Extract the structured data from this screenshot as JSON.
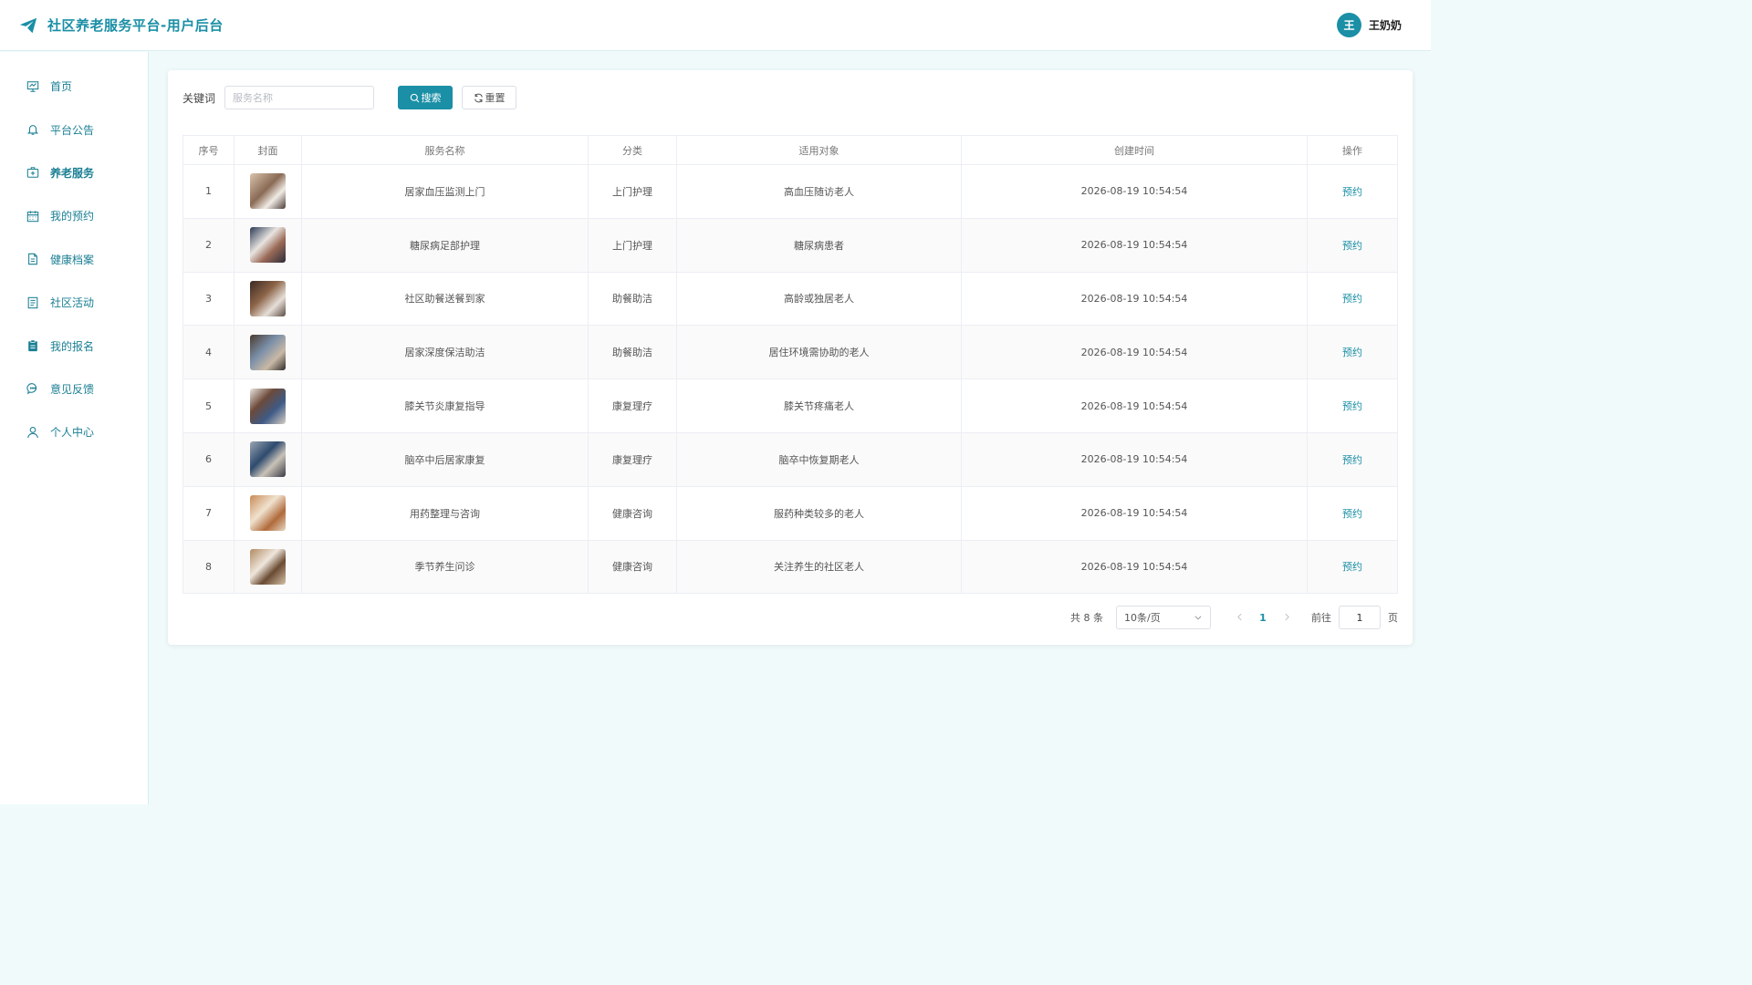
{
  "app": {
    "title": "社区养老服务平台-用户后台",
    "brand_icon": "paper-plane-icon",
    "accent": "#1a8fa6"
  },
  "user": {
    "avatar_letter": "王",
    "name": "王奶奶"
  },
  "sidebar": {
    "items": [
      {
        "label": "首页",
        "icon": "presentation-icon"
      },
      {
        "label": "平台公告",
        "icon": "bell-icon"
      },
      {
        "label": "养老服务",
        "icon": "medical-kit-icon",
        "active": true
      },
      {
        "label": "我的预约",
        "icon": "calendar-icon"
      },
      {
        "label": "健康档案",
        "icon": "document-icon"
      },
      {
        "label": "社区活动",
        "icon": "list-document-icon"
      },
      {
        "label": "我的报名",
        "icon": "clipboard-icon"
      },
      {
        "label": "意见反馈",
        "icon": "chat-icon"
      },
      {
        "label": "个人中心",
        "icon": "user-icon"
      }
    ]
  },
  "search": {
    "label": "关键词",
    "placeholder": "服务名称",
    "value": "",
    "search_label": "搜索",
    "reset_label": "重置"
  },
  "table": {
    "headers": [
      "序号",
      "封面",
      "服务名称",
      "分类",
      "适用对象",
      "创建时间",
      "操作"
    ],
    "rows": [
      {
        "no": "1",
        "name": "居家血压监测上门",
        "category": "上门护理",
        "target": "高血压随访老人",
        "created": "2026-08-19 10:54:54",
        "action": "预约"
      },
      {
        "no": "2",
        "name": "糖尿病足部护理",
        "category": "上门护理",
        "target": "糖尿病患者",
        "created": "2026-08-19 10:54:54",
        "action": "预约"
      },
      {
        "no": "3",
        "name": "社区助餐送餐到家",
        "category": "助餐助洁",
        "target": "高龄或独居老人",
        "created": "2026-08-19 10:54:54",
        "action": "预约"
      },
      {
        "no": "4",
        "name": "居家深度保洁助洁",
        "category": "助餐助洁",
        "target": "居住环境需协助的老人",
        "created": "2026-08-19 10:54:54",
        "action": "预约"
      },
      {
        "no": "5",
        "name": "膝关节炎康复指导",
        "category": "康复理疗",
        "target": "膝关节疼痛老人",
        "created": "2026-08-19 10:54:54",
        "action": "预约"
      },
      {
        "no": "6",
        "name": "脑卒中后居家康复",
        "category": "康复理疗",
        "target": "脑卒中恢复期老人",
        "created": "2026-08-19 10:54:54",
        "action": "预约"
      },
      {
        "no": "7",
        "name": "用药整理与咨询",
        "category": "健康咨询",
        "target": "服药种类较多的老人",
        "created": "2026-08-19 10:54:54",
        "action": "预约"
      },
      {
        "no": "8",
        "name": "季节养生问诊",
        "category": "健康咨询",
        "target": "关注养生的社区老人",
        "created": "2026-08-19 10:54:54",
        "action": "预约"
      }
    ]
  },
  "pagination": {
    "total_text": "共 8 条",
    "page_size": "10条/页",
    "current_page": "1",
    "goto_label": "前往",
    "goto_value": "1",
    "goto_suffix": "页"
  }
}
